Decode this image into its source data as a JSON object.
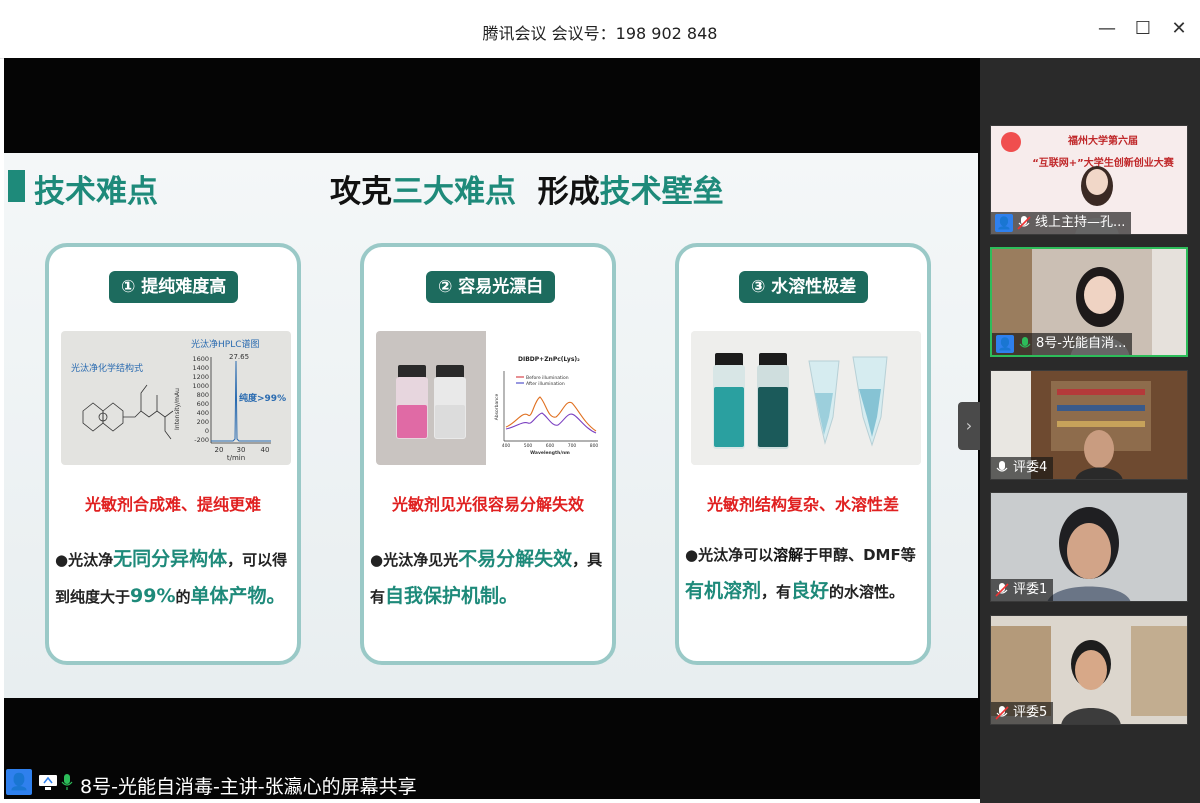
{
  "window": {
    "title": "腾讯会议 会议号：198 902 848",
    "minimize": "—",
    "maximize": "☐",
    "close": "✕"
  },
  "slide": {
    "section_title": "技术难点",
    "headline_a": "攻克",
    "headline_b": "三大难点",
    "headline_c": "  形成",
    "headline_d": "技术壁垒",
    "cards": [
      {
        "pill": "① 提纯难度高",
        "pic_caption_a": "光汰净化学结构式",
        "pic_caption_b": "光汰净HPLC谱图",
        "pic_peak": "27.65",
        "pic_purity": "纯度>99%",
        "pic_yticks": [
          "1600",
          "1400",
          "1200",
          "1000",
          "800",
          "600",
          "400",
          "200",
          "0",
          "-200"
        ],
        "pic_xticks": [
          "20",
          "30",
          "40"
        ],
        "pic_xlabel": "t/min",
        "pic_ylabel": "Intensity/mAu",
        "red": "光敏剂合成难、提纯更难",
        "b1": "●光汰净",
        "b2": "无同分异构体",
        "b3": "，可以得到纯度大于",
        "b4": "99%",
        "b5": "的",
        "b6": "单体产物。"
      },
      {
        "pill": "② 容易光漂白",
        "pic_title": "DIBDP+ZnPc(Lys)₂",
        "legend_a": "Before illumination",
        "legend_b": "After illumination",
        "pic_xlabel": "Wavelength/nm",
        "pic_ylabel": "Absorbance",
        "pic_xticks": [
          "400",
          "500",
          "600",
          "700",
          "800"
        ],
        "red": "光敏剂见光很容易分解失效",
        "b1": "●光汰净见光",
        "b2": "不易分解失效",
        "b3": "，具有",
        "b4": "自我保护机制。"
      },
      {
        "pill": "③ 水溶性极差",
        "red": "光敏剂结构复杂、水溶性差",
        "b1": "●光汰净可以",
        "b2": "溶解于",
        "b3": "甲醇、DMF等",
        "b4": "有机溶剂",
        "b5": "，有",
        "b6": "良好",
        "b7": "的水溶性。"
      }
    ]
  },
  "sidebar": {
    "toggle": "›",
    "tiles": [
      {
        "label": "线上主持—孔...",
        "banner_a": "福州大学第六届",
        "banner_b": "“互联网+”大学生创新创业大赛"
      },
      {
        "label": "8号-光能自消..."
      },
      {
        "label": "评委4"
      },
      {
        "label": "评委1"
      },
      {
        "label": "评委5"
      }
    ]
  },
  "share_bar": {
    "text": "8号-光能自消毒-主讲-张瀛心的屏幕共享"
  },
  "colors": {
    "teal": "#1e8a7a",
    "pill": "#1d6b5e",
    "red": "#e02020",
    "active_border": "#2dbd5a",
    "user_badge": "#2f80ed"
  }
}
